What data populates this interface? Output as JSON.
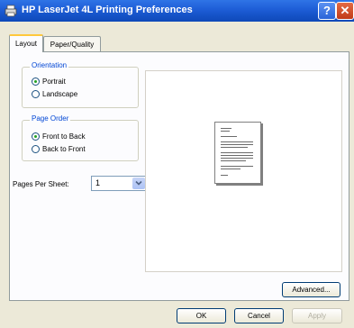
{
  "window": {
    "title": "HP LaserJet 4L Printing Preferences",
    "help_label": "?",
    "close_label": "✕"
  },
  "tabs": [
    {
      "label": "Layout",
      "active": true
    },
    {
      "label": "Paper/Quality",
      "active": false
    }
  ],
  "orientation": {
    "legend": "Orientation",
    "options": [
      {
        "label": "Portrait",
        "selected": true
      },
      {
        "label": "Landscape",
        "selected": false
      }
    ]
  },
  "page_order": {
    "legend": "Page Order",
    "options": [
      {
        "label": "Front to Back",
        "selected": true
      },
      {
        "label": "Back to Front",
        "selected": false
      }
    ]
  },
  "pages_per_sheet": {
    "label": "Pages Per Sheet:",
    "value": "1"
  },
  "buttons": {
    "advanced": "Advanced...",
    "ok": "OK",
    "cancel": "Cancel",
    "apply": "Apply"
  },
  "colors": {
    "titlebar": "#1f5fd8",
    "legend": "#0046d5",
    "radio_dot": "#21a121",
    "tab_highlight": "#ffc83c"
  },
  "icons": {
    "window": "printer-icon",
    "select_arrow": "chevron-down-icon"
  }
}
